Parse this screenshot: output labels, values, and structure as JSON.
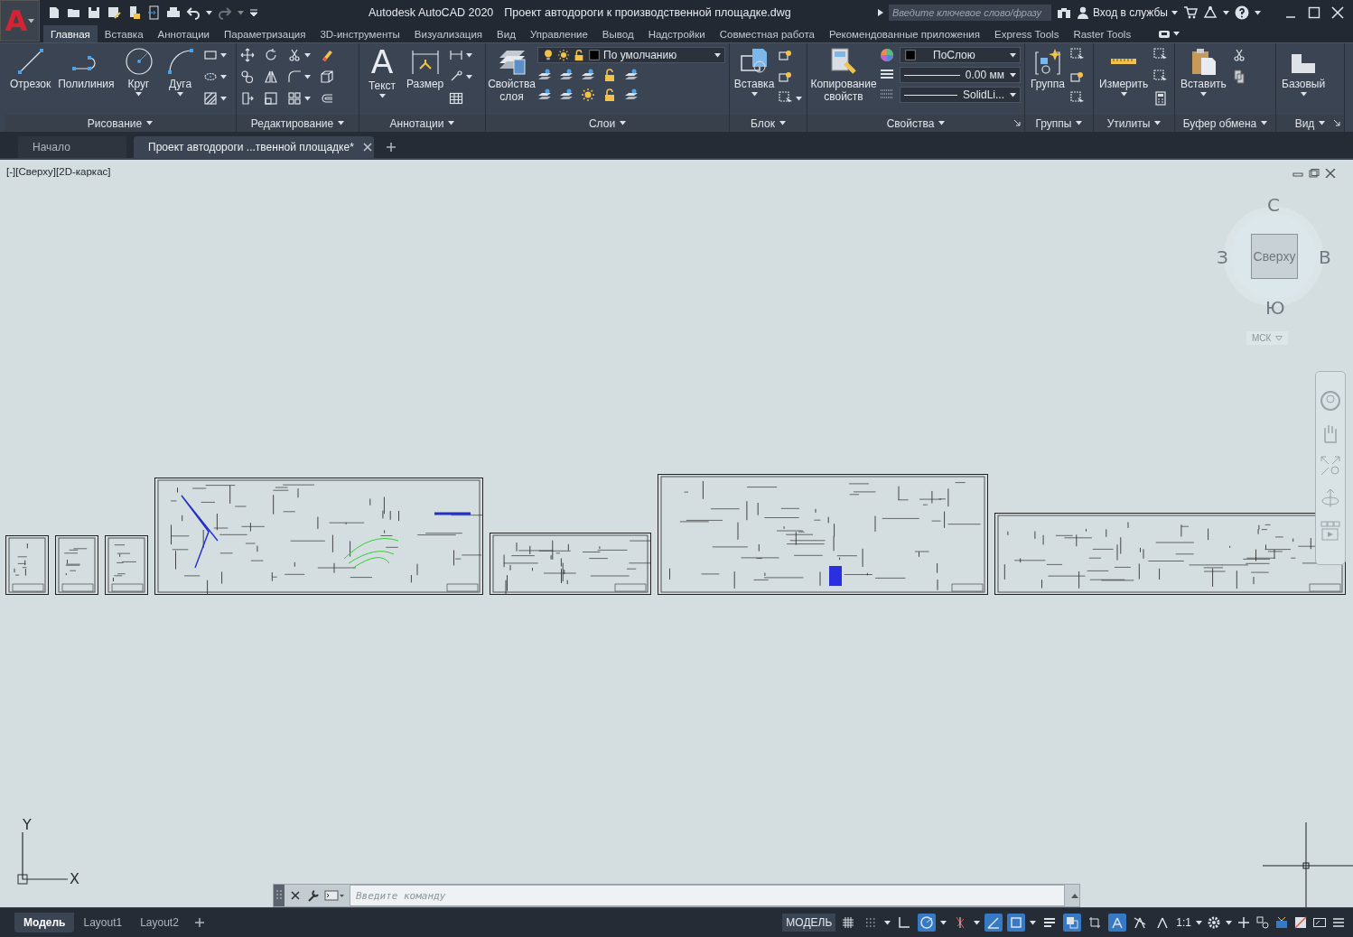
{
  "title_bar": {
    "app_button": "A",
    "app_title": "Autodesk AutoCAD 2020",
    "file_name": "Проект автодороги к производственной площадке.dwg",
    "search": {
      "placeholder": "Введите ключевое слово/фразу"
    },
    "sign_in": "Вход в службы"
  },
  "ribbon_tabs": [
    {
      "label": "Главная",
      "selected": true
    },
    {
      "label": "Вставка",
      "selected": false
    },
    {
      "label": "Аннотации",
      "selected": false
    },
    {
      "label": "Параметризация",
      "selected": false
    },
    {
      "label": "3D-инструменты",
      "selected": false
    },
    {
      "label": "Визуализация",
      "selected": false
    },
    {
      "label": "Вид",
      "selected": false
    },
    {
      "label": "Управление",
      "selected": false
    },
    {
      "label": "Вывод",
      "selected": false
    },
    {
      "label": "Надстройки",
      "selected": false
    },
    {
      "label": "Совместная работа",
      "selected": false
    },
    {
      "label": "Рекомендованные приложения",
      "selected": false
    },
    {
      "label": "Express Tools",
      "selected": false
    },
    {
      "label": "Raster Tools",
      "selected": false
    }
  ],
  "ribbon_panels": [
    {
      "title": "Рисование",
      "launcher": false,
      "tools": [
        {
          "label": "Отрезок",
          "dropdown": false
        },
        {
          "label": "Полилиния",
          "dropdown": false
        },
        {
          "label": "Круг",
          "dropdown": true
        },
        {
          "label": "Дуга",
          "dropdown": true
        }
      ]
    },
    {
      "title": "Редактирование",
      "launcher": false
    },
    {
      "title": "Аннотации",
      "launcher": false,
      "tools": [
        {
          "label": "Текст",
          "glyph": "A",
          "dropdown": true
        },
        {
          "label": "Размер",
          "dropdown": false
        }
      ]
    },
    {
      "title": "Слои",
      "launcher": false,
      "tools": [
        {
          "label": "Свойства слоя",
          "dropdown": false
        }
      ],
      "layer_dropdown": "По умолчанию"
    },
    {
      "title": "Блок",
      "launcher": false,
      "tools": [
        {
          "label": "Вставка",
          "dropdown": true
        }
      ]
    },
    {
      "title": "Свойства",
      "launcher": true,
      "tools": [
        {
          "label": "Копирование свойств",
          "dropdown": false
        }
      ],
      "dropdowns": [
        "ПоСлою",
        "0.00 мм",
        "SolidLi..."
      ]
    },
    {
      "title": "Группы",
      "launcher": false,
      "tools": [
        {
          "label": "Группа",
          "dropdown": false
        }
      ]
    },
    {
      "title": "Утилиты",
      "launcher": false,
      "tools": [
        {
          "label": "Измерить",
          "dropdown": true
        }
      ]
    },
    {
      "title": "Буфер обмена",
      "launcher": false,
      "tools": [
        {
          "label": "Вставить",
          "dropdown": true
        }
      ]
    },
    {
      "title": "Вид",
      "launcher": true,
      "tools": [
        {
          "label": "Базовый",
          "dropdown": true
        }
      ]
    }
  ],
  "document_tabs": [
    {
      "label": "Начало",
      "selected": false,
      "closable": false
    },
    {
      "label": "Проект автодороги ...твенной площадке*",
      "selected": true,
      "closable": true
    }
  ],
  "viewport": {
    "label": "[-][Сверху][2D-каркас]",
    "viewcube": {
      "north": "С",
      "west": "З",
      "east": "В",
      "south": "Ю",
      "face": "Сверху",
      "ucs_menu": "МСК"
    },
    "ucs_icon": {
      "y_label": "Y",
      "x_label": "X"
    },
    "command_line": {
      "placeholder": "Введите команду"
    }
  },
  "layout_tabs": [
    {
      "label": "Модель",
      "selected": true
    },
    {
      "label": "Layout1",
      "selected": false
    },
    {
      "label": "Layout2",
      "selected": false
    }
  ],
  "status_bar": {
    "space": "МОДЕЛЬ",
    "annotation_scale": "1:1",
    "toggles": [
      {
        "on": false
      },
      {
        "on": false
      },
      {
        "on": false
      },
      {
        "on": true
      },
      {
        "on": false
      },
      {
        "on": true
      },
      {
        "on": true
      },
      {
        "on": false
      },
      {
        "on": true
      },
      {
        "on": false
      },
      {
        "on": true
      },
      {
        "on": false
      },
      {
        "on": false
      }
    ]
  }
}
